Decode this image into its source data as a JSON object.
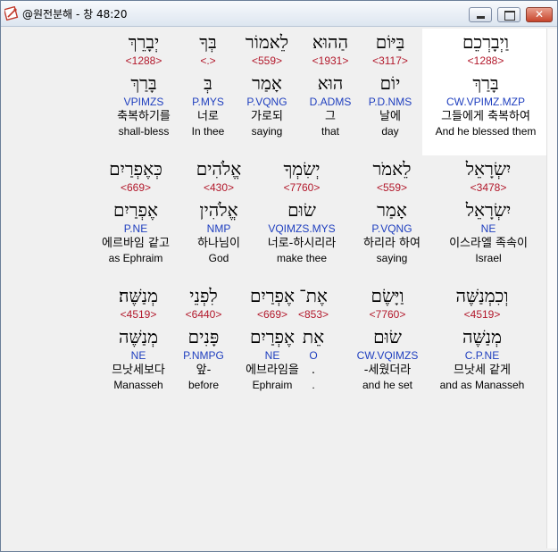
{
  "window": {
    "title": "@원전분해 - 창 48:20",
    "min_label": "",
    "max_label": "",
    "close_label": "✕"
  },
  "rows": [
    [
      {
        "heb": "וַיְבָרְכֵם",
        "strong": "<1288>",
        "lex": "בָּרַךְ",
        "morph": "CW.VPIMZ.MZP",
        "ko": "그들에게 축복하여",
        "en": "And he blessed them"
      },
      {
        "heb": "בַּיּוֹם",
        "strong": "<3117>",
        "lex": "יוֹם",
        "morph": "P.D.NMS",
        "ko": "날에",
        "en": "day"
      },
      {
        "heb": "הַהוּא",
        "strong": "<1931>",
        "lex": "הוּא",
        "morph": "D.ADMS",
        "ko": "그",
        "en": "that"
      },
      {
        "heb": "לֵאמוֹר",
        "strong": "<559>",
        "lex": "אָמַר",
        "morph": "P.VQNG",
        "ko": "가로되",
        "en": "saying"
      },
      {
        "heb": "בְּךָ",
        "strong": "<.>",
        "lex": "בְּ",
        "morph": "P.MYS",
        "ko": "너로",
        "en": "In thee"
      },
      {
        "heb": "יְבָרֵךְ",
        "strong": "<1288>",
        "lex": "בָּרַךְ",
        "morph": "VPIMZS",
        "ko": "축복하기를",
        "en": "shall-bless"
      }
    ],
    [
      {
        "heb": "יִשְׂרָאֵל",
        "strong": "<3478>",
        "lex": "יִשְׂרָאֵל",
        "morph": "NE",
        "ko": "이스라엘 족속이",
        "en": "Israel"
      },
      {
        "heb": "לֵאמֹר",
        "strong": "<559>",
        "lex": "אָמַר",
        "morph": "P.VQNG",
        "ko": "하리라 하여",
        "en": "saying"
      },
      {
        "heb": "יְשִׂמְךָ",
        "strong": "<7760>",
        "lex": "שׂוּם",
        "morph": "VQIMZS.MYS",
        "ko": "너로-하시리라",
        "en": "make thee"
      },
      {
        "heb": "אֱלֹהִים",
        "strong": "<430>",
        "lex": "אֱלֹהִין",
        "morph": "NMP",
        "ko": "하나님이",
        "en": "God"
      },
      {
        "heb": "כְּאֶפְרַיִם",
        "strong": "<669>",
        "lex": "אֶפְרַיִם",
        "morph": "P.NE",
        "ko": "에르바임 같고",
        "en": "as Ephraim"
      }
    ],
    [
      {
        "heb": "וְכִמְנַשֶּׁה",
        "strong": "<4519>",
        "lex": "מְנַשֶּׁה",
        "morph": "C.P.NE",
        "ko": "므낫세 같게",
        "en": "and as Manasseh"
      },
      {
        "heb": "וַיָּשֶׂם",
        "strong": "<7760>",
        "lex": "שׂוּם",
        "morph": "CW.VQIMZS",
        "ko": "-세웠더라",
        "en": "and he set"
      },
      {
        "heb": "אֶת־",
        "strong": "<853>",
        "lex": "אֵת",
        "morph": "O",
        "ko": ".",
        "en": "."
      },
      {
        "heb": "אֶפְרַיִם",
        "strong": "<669>",
        "lex": "אֶפְרַיִם",
        "morph": "NE",
        "ko": "에브라임을",
        "en": "Ephraim"
      },
      {
        "heb": "לִפְנֵי",
        "strong": "<6440>",
        "lex": "פָּנִים",
        "morph": "P.NMPG",
        "ko": "앞-",
        "en": "before"
      },
      {
        "heb": "מְנַשֶּׁה׃",
        "strong": "<4519>",
        "lex": "מְנַשֶּׁה",
        "morph": "NE",
        "ko": "므낫세보다",
        "en": "Manasseh"
      }
    ]
  ]
}
